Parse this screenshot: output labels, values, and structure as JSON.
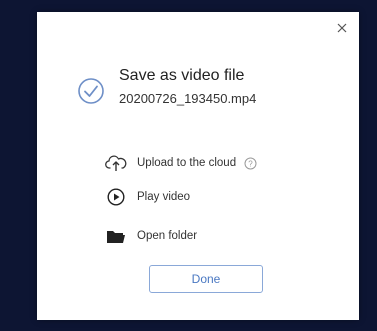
{
  "dialog": {
    "title": "Save as video file",
    "filename": "20200726_193450.mp4",
    "close_icon": "close-icon",
    "status_icon": "check-circle-icon",
    "actions": [
      {
        "label": "Upload to the cloud",
        "icon": "cloud-upload-icon",
        "has_help": true
      },
      {
        "label": "Play video",
        "icon": "play-circle-icon"
      },
      {
        "label": "Open folder",
        "icon": "folder-icon"
      }
    ],
    "done_label": "Done"
  },
  "colors": {
    "backdrop": "#0d1533",
    "dialog_bg": "#ffffff",
    "accent": "#4a78c2",
    "check_icon": "#6e8fc7",
    "done_border": "#8aa8d8"
  }
}
